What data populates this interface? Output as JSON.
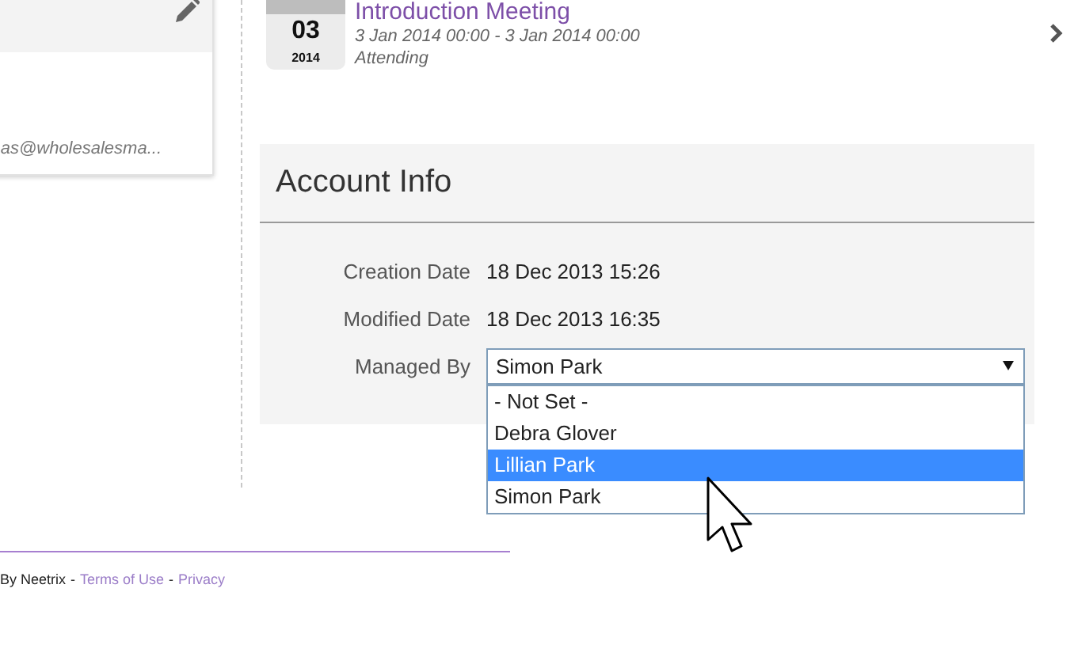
{
  "contact_card": {
    "email": "as@wholesalesma..."
  },
  "event": {
    "day": "03",
    "year": "2014",
    "title": "Introduction Meeting",
    "time": "3 Jan 2014 00:00 - 3 Jan 2014 00:00",
    "status": "Attending"
  },
  "account_info": {
    "title": "Account Info",
    "fields": [
      {
        "label": "Creation Date",
        "kind": "text",
        "value": "18 Dec 2013 15:26"
      },
      {
        "label": "Modified Date",
        "kind": "text",
        "value": "18 Dec 2013 16:35"
      },
      {
        "label": "Managed By",
        "kind": "select",
        "value": "Simon Park",
        "expanded": true,
        "options": [
          {
            "label": "- Not Set -",
            "highlighted": false
          },
          {
            "label": "Debra Glover",
            "highlighted": false
          },
          {
            "label": "Lillian Park",
            "highlighted": true
          },
          {
            "label": "Simon Park",
            "highlighted": false
          }
        ]
      }
    ]
  },
  "footer": {
    "items": [
      {
        "kind": "text",
        "text": "By Neetrix"
      },
      {
        "kind": "separator",
        "text": "-"
      },
      {
        "kind": "link",
        "text": "Terms of Use"
      },
      {
        "kind": "separator",
        "text": "-"
      },
      {
        "kind": "link",
        "text": "Privacy"
      }
    ]
  }
}
